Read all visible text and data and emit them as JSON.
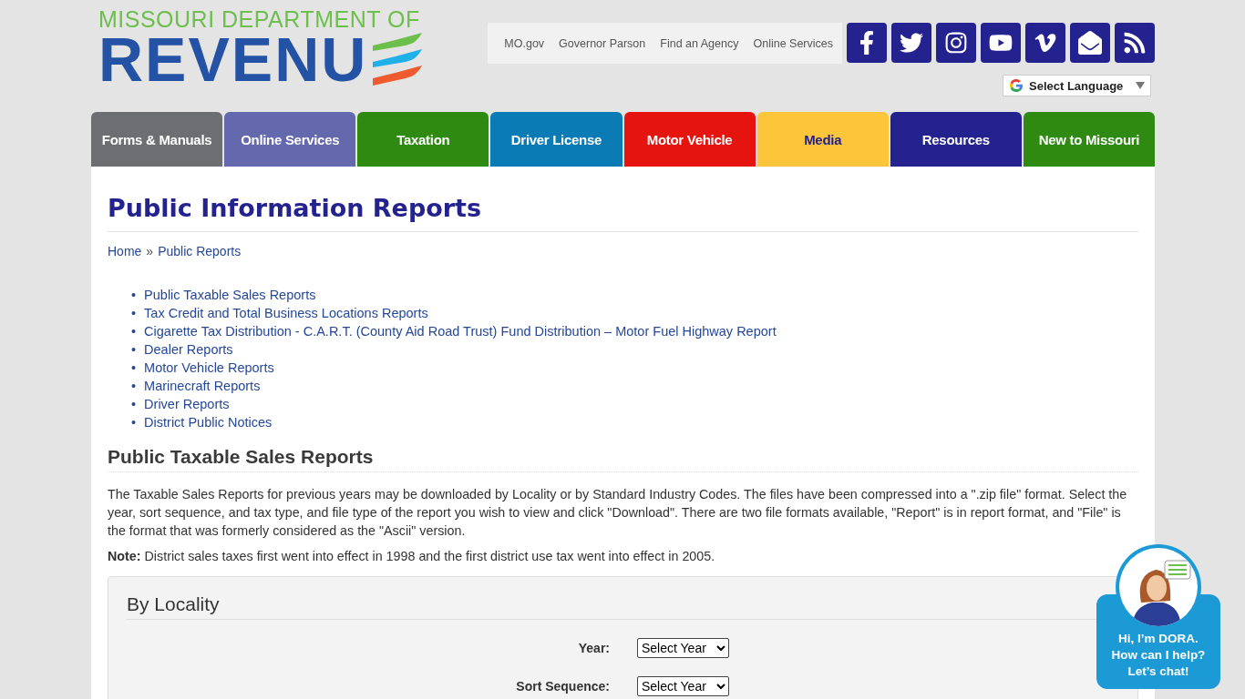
{
  "logo": {
    "tagline": "MISSOURI DEPARTMENT OF",
    "word": "REVENU"
  },
  "utility_links": [
    {
      "label": "MO.gov"
    },
    {
      "label": "Governor Parson"
    },
    {
      "label": "Find an Agency"
    },
    {
      "label": "Online Services"
    }
  ],
  "social": [
    {
      "kind": "facebook"
    },
    {
      "kind": "twitter"
    },
    {
      "kind": "instagram"
    },
    {
      "kind": "youtube"
    },
    {
      "kind": "vimeo"
    },
    {
      "kind": "mail"
    },
    {
      "kind": "rss"
    }
  ],
  "language": {
    "label": "Select Language"
  },
  "nav": [
    {
      "label": "Forms & Manuals",
      "color": "#6d6e71"
    },
    {
      "label": "Online Services",
      "color": "#6469ad"
    },
    {
      "label": "Taxation",
      "color": "#2f8a12"
    },
    {
      "label": "Driver License",
      "color": "#0b7bb5"
    },
    {
      "label": "Motor Vehicle",
      "color": "#e5140f"
    },
    {
      "label": "Media",
      "color": "#fcc53a"
    },
    {
      "label": "Resources",
      "color": "#24228e"
    },
    {
      "label": "New to Missouri",
      "color": "#2f8a12"
    }
  ],
  "page_title": "Public Information Reports",
  "breadcrumb": [
    {
      "label": "Home"
    },
    {
      "label": "Public Reports"
    }
  ],
  "breadcrumb_separator": "»",
  "list_marker": "•",
  "report_links": [
    {
      "label": "Public Taxable Sales Reports"
    },
    {
      "label": "Tax Credit and Total Business Locations Reports"
    },
    {
      "label": "Cigarette Tax Distribution - C.A.R.T. (County Aid Road Trust) Fund Distribution – Motor Fuel Highway Report"
    },
    {
      "label": "Dealer Reports"
    },
    {
      "label": "Motor Vehicle Reports"
    },
    {
      "label": "Marinecraft Reports"
    },
    {
      "label": "Driver Reports"
    },
    {
      "label": "District Public Notices"
    }
  ],
  "section_title": "Public Taxable Sales Reports",
  "intro": "The Taxable Sales Reports for previous years may be downloaded by Locality or by Standard Industry Codes. The files have been compressed into a \".zip file\" format. Select the year, sort sequence, and tax type, and file type of the report you wish to view and click \"Download\". There are two file formats available, \"Report\" is in report format, and \"File\" is the format that was formerly considered as the \"Ascii\" version.",
  "note": "**Note:** District sales taxes first went into effect in 1998 and the first district use tax went into effect in 2005.",
  "panel": {
    "title": "By Locality",
    "fields": [
      {
        "label": "Year:",
        "value": "Select Year"
      },
      {
        "label": "Sort Sequence:",
        "value": "Select Year"
      }
    ]
  },
  "chat": {
    "lines": [
      "Hi, I’m DORA.",
      "How can I help?",
      "Let’s chat!"
    ]
  }
}
